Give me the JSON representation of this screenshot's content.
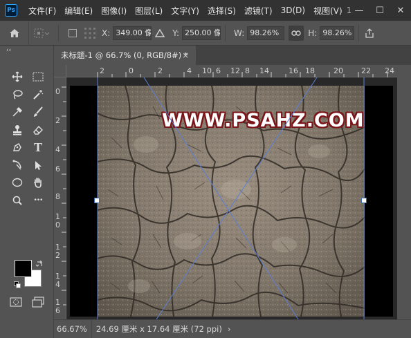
{
  "app": {
    "logo_text": "Ps"
  },
  "menu": {
    "items": [
      "文件(F)",
      "编辑(E)",
      "图像(I)",
      "图层(L)",
      "文字(Y)",
      "选择(S)",
      "滤镜(T)",
      "3D(D)",
      "视图(V)",
      "1"
    ]
  },
  "window_controls": {
    "minimize": "—",
    "maximize": "☐",
    "close": "✕"
  },
  "options": {
    "x_label": "X:",
    "x_value": "349.00 像",
    "y_label": "Y:",
    "y_value": "250.00 像",
    "w_label": "W:",
    "w_value": "98.26%",
    "h_label": "H:",
    "h_value": "98.26%"
  },
  "tools": {
    "icons": [
      "move-icon",
      "marquee-icon",
      "lasso-icon",
      "magic-wand-icon",
      "eyedropper-icon",
      "brush-icon",
      "stamp-icon",
      "eraser-icon",
      "pen-icon",
      "type-icon",
      "path-select-icon",
      "direct-select-icon",
      "ellipse-icon",
      "hand-icon",
      "zoom-icon",
      "more-icon"
    ],
    "type_glyph": "T",
    "more_glyph": "•••",
    "collapse_glyph": "‹‹",
    "foreground_color": "#000000",
    "background_color": "#ffffff"
  },
  "document": {
    "tab_title": "未标题-1 @ 66.7% (0, RGB/8#) *",
    "tab_close": "×"
  },
  "ruler": {
    "top_ticks": [
      "2",
      "0",
      "2",
      "4",
      "6",
      "8",
      "10",
      "12",
      "14",
      "16",
      "18",
      "20",
      "22",
      "24"
    ],
    "left_ticks": [
      "0",
      "2",
      "4",
      "6",
      "8",
      "1 0",
      "1 2",
      "1 4",
      "1 6"
    ]
  },
  "canvas": {
    "watermark": "WWW.PSAHZ.COM",
    "watermark_outline_color": "#7a1418",
    "transform_line_color": "#5b7fd6"
  },
  "status": {
    "zoom": "66.67%",
    "info": "24.69 厘米 x 17.64 厘米 (72 ppi)",
    "arrow": "›"
  }
}
